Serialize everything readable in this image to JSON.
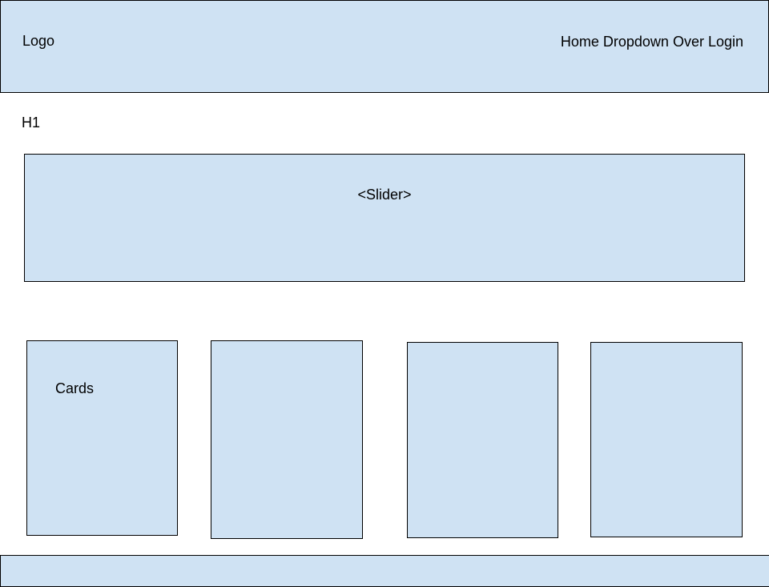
{
  "header": {
    "logo": "Logo",
    "nav": [
      "Home",
      "Dropdown",
      "Over",
      "Login"
    ]
  },
  "main": {
    "h1": "H1",
    "slider_label": "<Slider>",
    "cards_label": "Cards"
  },
  "colors": {
    "box_fill": "#cfe2f3",
    "border": "#000000",
    "background": "#ffffff"
  }
}
